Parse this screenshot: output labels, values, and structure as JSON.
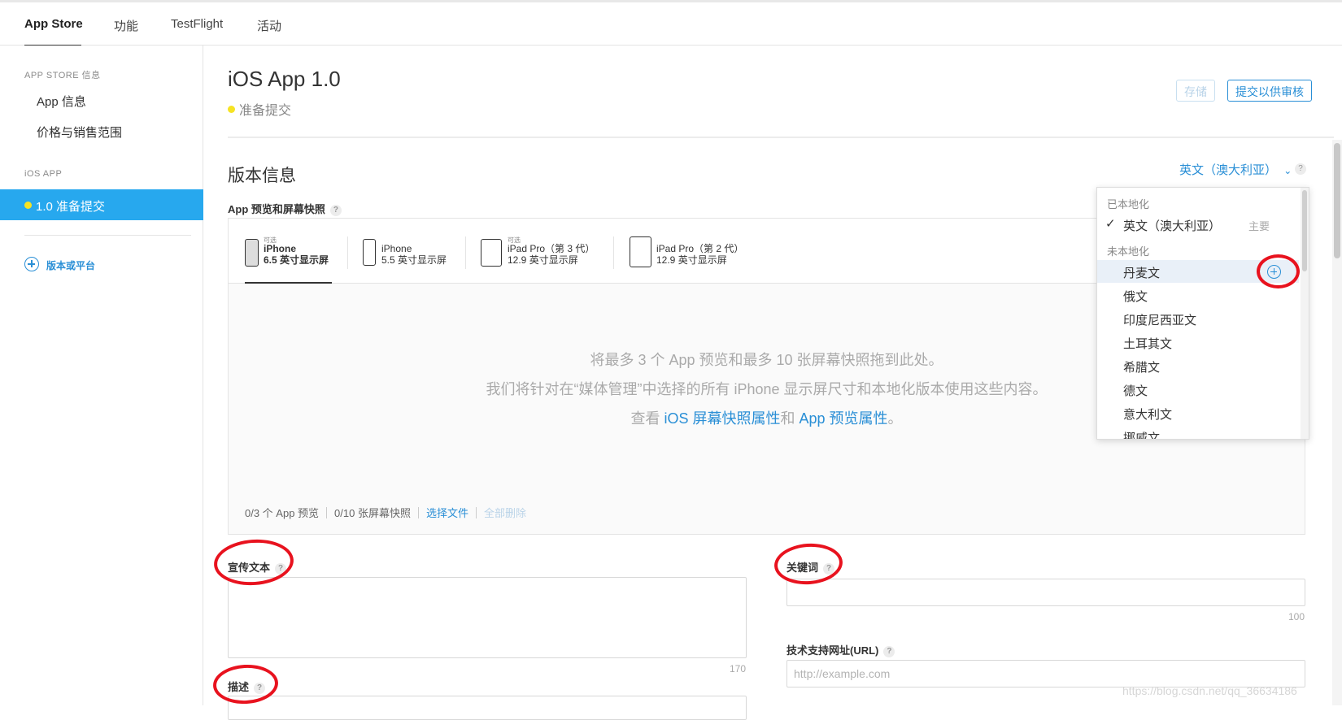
{
  "topnav": {
    "tabs": [
      {
        "label": "App Store",
        "active": true
      },
      {
        "label": "功能"
      },
      {
        "label": "TestFlight"
      },
      {
        "label": "活动"
      }
    ]
  },
  "sidebar": {
    "section_appstore": "APP STORE 信息",
    "item_app_info": "App 信息",
    "item_pricing": "价格与销售范围",
    "section_ios": "iOS APP",
    "item_version": "1.0 准备提交",
    "add_version": "版本或平台"
  },
  "header": {
    "title": "iOS App 1.0",
    "status": "准备提交",
    "save_label": "存储",
    "submit_label": "提交以供审核"
  },
  "version_info": {
    "title": "版本信息",
    "language": "英文（澳大利亚）",
    "help": "?"
  },
  "media": {
    "label": "App 预览和屏幕快照",
    "devices": [
      {
        "optional": "可选",
        "name": "iPhone",
        "size": "6.5 英寸显示屏"
      },
      {
        "optional": "",
        "name": "iPhone",
        "size": "5.5 英寸显示屏"
      },
      {
        "optional": "可选",
        "name": "iPad Pro（第 3 代）",
        "size": "12.9 英寸显示屏"
      },
      {
        "optional": "",
        "name": "iPad Pro（第 2 代）",
        "size": "12.9 英寸显示屏"
      }
    ],
    "drop_line1": "将最多 3 个 App 预览和最多 10 张屏幕快照拖到此处。",
    "drop_line2": "我们将针对在“媒体管理”中选择的所有 iPhone 显示屏尺寸和本地化版本使用这些内容。",
    "drop_line3_prefix": "查看 ",
    "drop_line3_link1": "iOS 屏幕快照属性",
    "drop_line3_mid": "和 ",
    "drop_line3_link2": "App 预览属性",
    "drop_line3_suffix": "。",
    "count_previews": "0/3 个 App 预览",
    "count_screenshots": "0/10 张屏幕快照",
    "choose_file": "选择文件",
    "delete_all": "全部删除"
  },
  "form": {
    "promo_label": "宣传文本",
    "promo_counter": "170",
    "description_label": "描述",
    "keywords_label": "关键词",
    "keywords_counter": "100",
    "support_url_label": "技术支持网址(URL)",
    "support_url_placeholder": "http://example.com"
  },
  "dropdown": {
    "localized_header": "已本地化",
    "selected": "英文（澳大利亚）",
    "primary_tag": "主要",
    "unlocalized_header": "未本地化",
    "languages": [
      "丹麦文",
      "俄文",
      "印度尼西亚文",
      "土耳其文",
      "希腊文",
      "德文",
      "意大利文",
      "挪威文"
    ]
  },
  "watermark": "https://blog.csdn.net/qq_36634186",
  "colors": {
    "accent": "#2a8fd6",
    "sidebar_active": "#27a8ee",
    "status_dot": "#f6e323",
    "annotation": "#e8121e"
  }
}
